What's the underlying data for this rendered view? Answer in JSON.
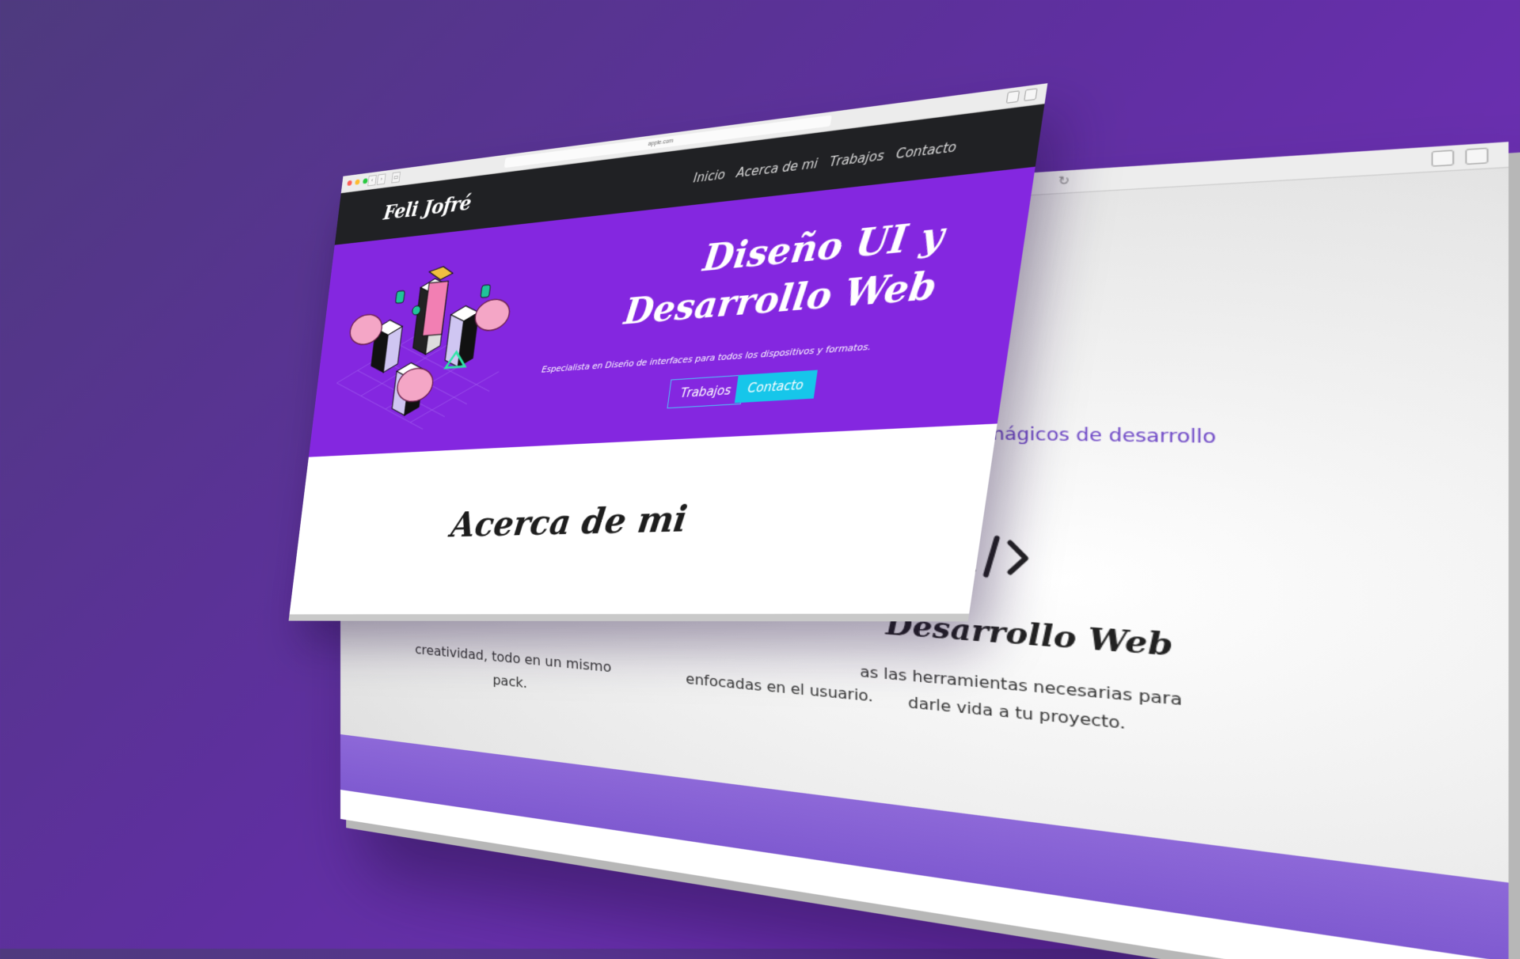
{
  "back_window": {
    "tagline": "y poderes mágicos de desarrollo",
    "service_icon": "code-icon",
    "service_title": "Desarrollo Web",
    "service_text": "as las herramientas necesarias para darle vida a tu proyecto.",
    "col1_text": "creatividad, todo en un mismo pack.",
    "col2_text": "enfocadas en el usuario.",
    "footer_color": "#8d68d8"
  },
  "front_window": {
    "url": "apple.com",
    "nav": {
      "logo": "Feli Jofré",
      "items": [
        "Inicio",
        "Acerca de mi",
        "Trabajos",
        "Contacto"
      ]
    },
    "hero": {
      "title_line1": "Diseño UI y",
      "title_line2": "Desarrollo Web",
      "subtitle": "Especialista en Diseño de interfaces para todos los dispositivos y formatos.",
      "btn_works": "Trabajos",
      "btn_contact": "Contacto",
      "illustration": "isometric-brains-illustration"
    },
    "about": {
      "title": "Acerca de mi"
    },
    "colors": {
      "hero_bg": "#8427e0",
      "nav_bg": "#202124",
      "accent": "#16c6ea"
    }
  }
}
